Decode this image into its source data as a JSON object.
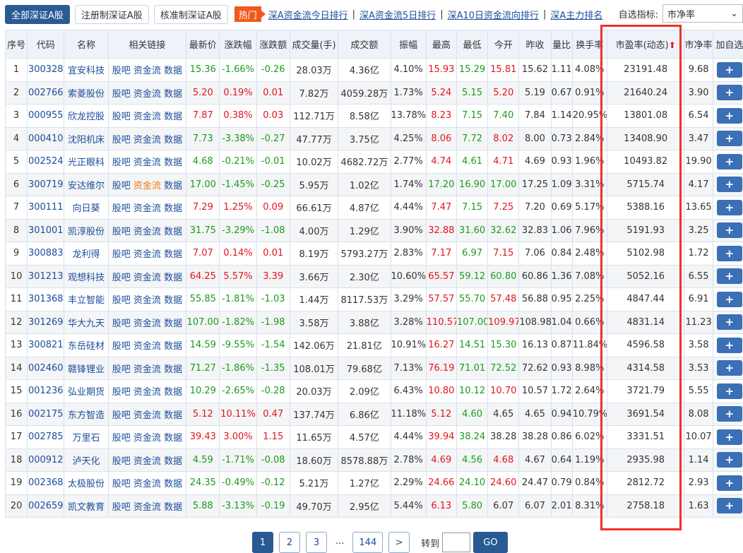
{
  "tabs": [
    "全部深证A股",
    "注册制深证A股",
    "核准制深证A股"
  ],
  "hot_label": "热门",
  "hot_links": [
    "深A资金流今日排行",
    "深A资金流5日排行",
    "深A10日资金流向排行",
    "深A主力排名"
  ],
  "picker": {
    "label": "自选指标:",
    "value": "市净率"
  },
  "headers": [
    "序号",
    "代码",
    "名称",
    "相关链接",
    "最新价",
    "涨跌幅",
    "涨跌额",
    "成交量(手)",
    "成交额",
    "振幅",
    "最高",
    "最低",
    "今开",
    "昨收",
    "量比",
    "换手率",
    "市盈率(动态)",
    "市净率",
    "加自选"
  ],
  "sort_icon": "arrow-up-icon",
  "link_labels": [
    "股吧",
    "资金流",
    "数据"
  ],
  "add_label": "+",
  "rows": [
    [
      "1",
      "300328",
      "宜安科技",
      "15.36",
      "-1.66%",
      "-0.26",
      "28.03万",
      "4.36亿",
      "4.10%",
      "15.93",
      "15.29",
      "15.81",
      "15.62",
      "1.11",
      "4.08%",
      "23191.48",
      "9.68"
    ],
    [
      "2",
      "002766",
      "索菱股份",
      "5.20",
      "0.19%",
      "0.01",
      "7.82万",
      "4059.28万",
      "1.73%",
      "5.24",
      "5.15",
      "5.20",
      "5.19",
      "0.67",
      "0.91%",
      "21640.24",
      "3.90"
    ],
    [
      "3",
      "000955",
      "欣龙控股",
      "7.87",
      "0.38%",
      "0.03",
      "112.71万",
      "8.58亿",
      "13.78%",
      "8.23",
      "7.15",
      "7.40",
      "7.84",
      "1.14",
      "20.95%",
      "13801.08",
      "6.54"
    ],
    [
      "4",
      "000410",
      "沈阳机床",
      "7.73",
      "-3.38%",
      "-0.27",
      "47.77万",
      "3.75亿",
      "4.25%",
      "8.06",
      "7.72",
      "8.02",
      "8.00",
      "0.73",
      "2.84%",
      "13408.90",
      "3.47"
    ],
    [
      "5",
      "002524",
      "光正眼科",
      "4.68",
      "-0.21%",
      "-0.01",
      "10.02万",
      "4682.72万",
      "2.77%",
      "4.74",
      "4.61",
      "4.71",
      "4.69",
      "0.93",
      "1.96%",
      "10493.82",
      "19.90"
    ],
    [
      "6",
      "300719",
      "安达维尔",
      "17.00",
      "-1.45%",
      "-0.25",
      "5.95万",
      "1.02亿",
      "1.74%",
      "17.20",
      "16.90",
      "17.00",
      "17.25",
      "1.09",
      "3.31%",
      "5715.74",
      "4.17"
    ],
    [
      "7",
      "300111",
      "向日葵",
      "7.29",
      "1.25%",
      "0.09",
      "66.61万",
      "4.87亿",
      "4.44%",
      "7.47",
      "7.15",
      "7.25",
      "7.20",
      "0.69",
      "5.17%",
      "5388.16",
      "13.65"
    ],
    [
      "8",
      "301001",
      "凯淳股份",
      "31.75",
      "-3.29%",
      "-1.08",
      "4.00万",
      "1.29亿",
      "3.90%",
      "32.88",
      "31.60",
      "32.62",
      "32.83",
      "1.06",
      "7.96%",
      "5191.93",
      "3.25"
    ],
    [
      "9",
      "300883",
      "龙利得",
      "7.07",
      "0.14%",
      "0.01",
      "8.19万",
      "5793.27万",
      "2.83%",
      "7.17",
      "6.97",
      "7.15",
      "7.06",
      "0.84",
      "2.48%",
      "5102.98",
      "1.72"
    ],
    [
      "10",
      "301213",
      "观想科技",
      "64.25",
      "5.57%",
      "3.39",
      "3.66万",
      "2.30亿",
      "10.60%",
      "65.57",
      "59.12",
      "60.80",
      "60.86",
      "1.36",
      "7.08%",
      "5052.16",
      "6.55"
    ],
    [
      "11",
      "301368",
      "丰立智能",
      "55.85",
      "-1.81%",
      "-1.03",
      "1.44万",
      "8117.53万",
      "3.29%",
      "57.57",
      "55.70",
      "57.48",
      "56.88",
      "0.95",
      "2.25%",
      "4847.44",
      "6.91"
    ],
    [
      "12",
      "301269",
      "华大九天",
      "107.00",
      "-1.82%",
      "-1.98",
      "3.58万",
      "3.88亿",
      "3.28%",
      "110.57",
      "107.00",
      "109.97",
      "108.98",
      "1.04",
      "0.66%",
      "4831.14",
      "11.23"
    ],
    [
      "13",
      "300821",
      "东岳硅材",
      "14.59",
      "-9.55%",
      "-1.54",
      "142.06万",
      "21.81亿",
      "10.91%",
      "16.27",
      "14.51",
      "15.30",
      "16.13",
      "0.87",
      "11.84%",
      "4596.58",
      "3.58"
    ],
    [
      "14",
      "002460",
      "赣锋锂业",
      "71.27",
      "-1.86%",
      "-1.35",
      "108.01万",
      "79.68亿",
      "7.13%",
      "76.19",
      "71.01",
      "72.52",
      "72.62",
      "0.93",
      "8.98%",
      "4314.58",
      "3.53"
    ],
    [
      "15",
      "001236",
      "弘业期货",
      "10.29",
      "-2.65%",
      "-0.28",
      "20.03万",
      "2.09亿",
      "6.43%",
      "10.80",
      "10.12",
      "10.70",
      "10.57",
      "1.72",
      "2.64%",
      "3721.79",
      "5.55"
    ],
    [
      "16",
      "002175",
      "东方智造",
      "5.12",
      "10.11%",
      "0.47",
      "137.74万",
      "6.86亿",
      "11.18%",
      "5.12",
      "4.60",
      "4.65",
      "4.65",
      "0.94",
      "10.79%",
      "3691.54",
      "8.08"
    ],
    [
      "17",
      "002785",
      "万里石",
      "39.43",
      "3.00%",
      "1.15",
      "11.65万",
      "4.57亿",
      "4.44%",
      "39.94",
      "38.24",
      "38.28",
      "38.28",
      "0.86",
      "6.02%",
      "3331.51",
      "10.07"
    ],
    [
      "18",
      "000912",
      "泸天化",
      "4.59",
      "-1.71%",
      "-0.08",
      "18.60万",
      "8578.88万",
      "2.78%",
      "4.69",
      "4.56",
      "4.68",
      "4.67",
      "0.64",
      "1.19%",
      "2935.98",
      "1.14"
    ],
    [
      "19",
      "002368",
      "太极股份",
      "24.35",
      "-0.49%",
      "-0.12",
      "5.21万",
      "1.27亿",
      "2.29%",
      "24.66",
      "24.10",
      "24.60",
      "24.47",
      "0.79",
      "0.84%",
      "2812.72",
      "2.93"
    ],
    [
      "20",
      "002659",
      "凯文教育",
      "5.88",
      "-3.13%",
      "-0.19",
      "49.70万",
      "2.95亿",
      "5.44%",
      "6.13",
      "5.80",
      "6.07",
      "6.07",
      "2.01",
      "8.31%",
      "2758.18",
      "1.63"
    ]
  ],
  "pagination": {
    "pages": [
      "1",
      "2",
      "3"
    ],
    "dots": "...",
    "last": "144",
    "next": ">",
    "goto_label": "转到",
    "go": "GO"
  }
}
